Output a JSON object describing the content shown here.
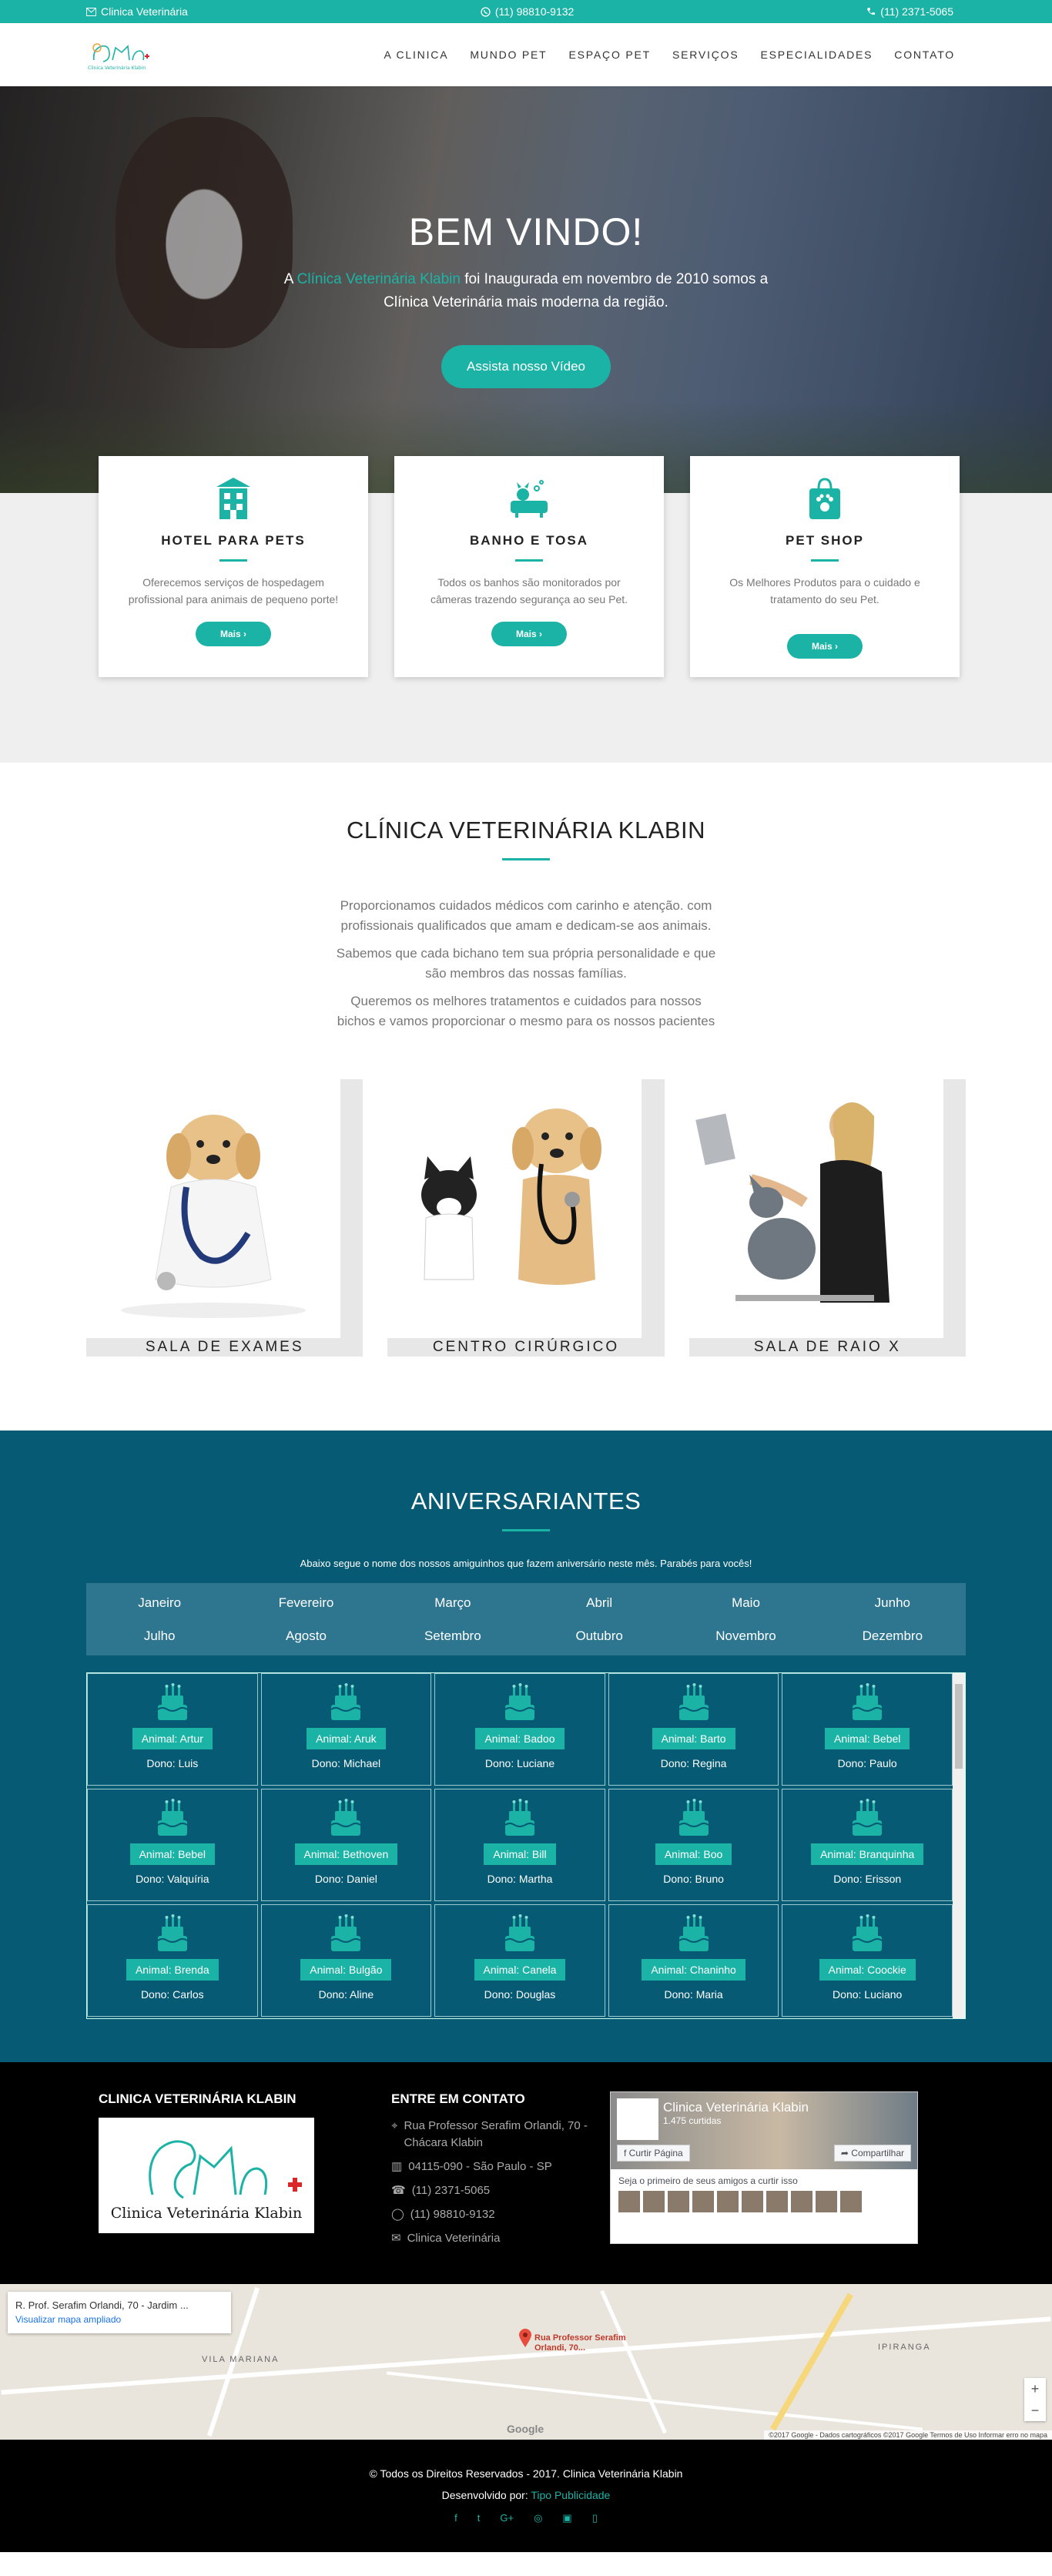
{
  "topbar": {
    "email": "Clinica Veterinária",
    "whatsapp": "(11) 98810-9132",
    "phone": "(11) 2371-5065"
  },
  "nav": {
    "logo_alt": "Clinica Veterinária Klabin",
    "items": [
      "A CLINICA",
      "MUNDO PET",
      "ESPAÇO PET",
      "SERVIÇOS",
      "ESPECIALIDADES",
      "CONTATO"
    ]
  },
  "hero": {
    "title": "BEM VINDO!",
    "text_before": "A ",
    "text_highlight": "Clínica Veterinária Klabin",
    "text_after": " foi Inaugurada em novembro de 2010 somos a Clínica Veterinária mais moderna da região.",
    "button": "Assista nosso Vídeo"
  },
  "services": [
    {
      "title": "HOTEL PARA PETS",
      "text": "Oferecemos serviços de hospedagem profissional para animais de pequeno porte!",
      "button": "Mais ›",
      "icon": "hotel-icon"
    },
    {
      "title": "BANHO E TOSA",
      "text": "Todos os banhos são monitorados por câmeras trazendo segurança ao seu Pet.",
      "button": "Mais ›",
      "icon": "bath-icon"
    },
    {
      "title": "PET SHOP",
      "text": "Os Melhores Produtos para o cuidado e tratamento do seu Pet.",
      "button": "Mais ›",
      "icon": "shopping-bag-icon"
    }
  ],
  "about": {
    "title": "CLÍNICA VETERINÁRIA KLABIN",
    "paragraphs": [
      "Proporcionamos cuidados médicos com carinho e atenção. com profissionais qualificados que amam e dedicam-se aos animais.",
      "Sabemos que cada bichano tem sua própria personalidade e que são membros das nossas famílias.",
      "Queremos os melhores tratamentos e cuidados para nossos bichos e vamos proporcionar o mesmo para os nossos pacientes"
    ],
    "rooms": [
      "SALA DE EXAMES",
      "CENTRO CIRÚRGICO",
      "SALA DE RAIO X"
    ]
  },
  "birthdays": {
    "title": "ANIVERSARIANTES",
    "intro": "Abaixo segue o nome dos nossos amiguinhos que fazem aniversário neste mês. Parabés para vocês!",
    "months": [
      "Janeiro",
      "Fevereiro",
      "Março",
      "Abril",
      "Maio",
      "Junho",
      "Julho",
      "Agosto",
      "Setembro",
      "Outubro",
      "Novembro",
      "Dezembro"
    ],
    "pets": [
      {
        "animal": "Animal: Artur",
        "owner": "Dono: Luis"
      },
      {
        "animal": "Animal: Aruk",
        "owner": "Dono: Michael"
      },
      {
        "animal": "Animal: Badoo",
        "owner": "Dono: Luciane"
      },
      {
        "animal": "Animal: Barto",
        "owner": "Dono: Regina"
      },
      {
        "animal": "Animal: Bebel",
        "owner": "Dono: Paulo"
      },
      {
        "animal": "Animal: Bebel",
        "owner": "Dono: Valquíria"
      },
      {
        "animal": "Animal: Bethoven",
        "owner": "Dono: Daniel"
      },
      {
        "animal": "Animal: Bill",
        "owner": "Dono: Martha"
      },
      {
        "animal": "Animal: Boo",
        "owner": "Dono: Bruno"
      },
      {
        "animal": "Animal: Branquinha",
        "owner": "Dono: Erisson"
      },
      {
        "animal": "Animal: Brenda",
        "owner": "Dono: Carlos"
      },
      {
        "animal": "Animal: Bulgão",
        "owner": "Dono: Aline"
      },
      {
        "animal": "Animal: Canela",
        "owner": "Dono: Douglas"
      },
      {
        "animal": "Animal: Chaninho",
        "owner": "Dono: Maria"
      },
      {
        "animal": "Animal: Coockie",
        "owner": "Dono: Luciano"
      }
    ]
  },
  "footer": {
    "col1_title": "CLINICA VETERINÁRIA KLABIN",
    "logo_text": "Clinica Veterinária Klabin",
    "col2_title": "ENTRE EM CONTATO",
    "address": "Rua Professor Serafim Orlandi, 70 - Chácara Klabin",
    "cep": "04115-090 - São Paulo - SP",
    "phone": "(11) 2371-5065",
    "whatsapp": "(11) 98810-9132",
    "email": "Clinica Veterinária",
    "fb_name": "Clinica Veterinária Klabin",
    "fb_likes": "1.475 curtidas",
    "fb_like_btn": "Curtir Página",
    "fb_share_btn": "Compartilhar",
    "fb_friends": "Seja o primeiro de seus amigos a curtir isso"
  },
  "map": {
    "place": "R. Prof. Serafim Orlandi, 70 - Jardim ...",
    "enlarge": "Visualizar mapa ampliado",
    "marker_label": "Rua Professor Serafim Orlandi, 70...",
    "district1": "VILA MARIANA",
    "district2": "IPIRANGA",
    "attribution": "©2017 Google - Dados cartográficos ©2017 Google   Termos de Uso   Informar erro no mapa"
  },
  "copyright": {
    "line1": "© Todos os Direitos Reservados - 2017. Clinica Veterinária Klabin",
    "dev_label": "Desenvolvido por: ",
    "dev_name": "Tipo Publicidade"
  },
  "colors": {
    "accent": "#1bb3a5",
    "birthday_bg": "#065a73",
    "months_bg": "#2e7690"
  }
}
